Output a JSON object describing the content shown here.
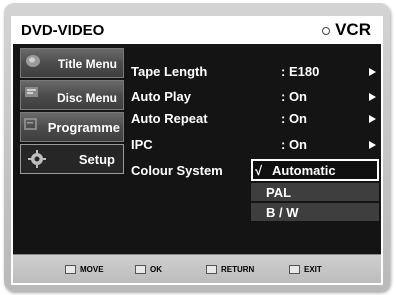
{
  "header": {
    "left_title": "DVD-VIDEO",
    "right_title": "VCR",
    "right_icon": "radio-circle-icon"
  },
  "sidebar": {
    "items": [
      {
        "label": "Title Menu",
        "icon": "disc-icon"
      },
      {
        "label": "Disc Menu",
        "icon": "disc-menu-icon"
      },
      {
        "label": "Programme",
        "icon": "programme-icon"
      },
      {
        "label": "Setup",
        "icon": "gear-icon",
        "active": true
      }
    ]
  },
  "menu": {
    "rows": [
      {
        "name": "Tape Length",
        "value": ": E180"
      },
      {
        "name": "Auto Play",
        "value": ": On"
      },
      {
        "name": "Auto Repeat",
        "value": ": On"
      },
      {
        "name": "IPC",
        "value": ": On"
      },
      {
        "name": "Colour System",
        "value": ""
      }
    ]
  },
  "dropdown": {
    "check_mark": "√",
    "options": [
      "Automatic",
      "PAL",
      "B / W"
    ]
  },
  "footer": {
    "move": "MOVE",
    "ok": "OK",
    "return": "RETURN",
    "exit": "EXIT"
  },
  "colors": {
    "panel": "#141414",
    "frame": "#c3c3c3",
    "highlight": "#ffffff"
  }
}
